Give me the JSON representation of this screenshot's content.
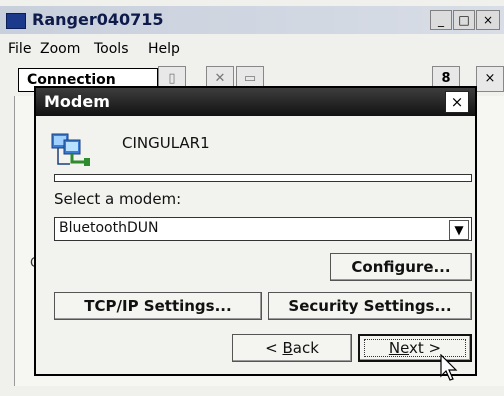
{
  "window": {
    "title": "Ranger040715",
    "minimize_label": "_",
    "maximize_label": "□",
    "close_label": "×"
  },
  "menubar": {
    "items": [
      "File",
      "Zoom",
      "Tools",
      "Help"
    ]
  },
  "toolbar": {
    "combo_text": "Connection",
    "right_partial_1": "8",
    "right_partial_2": "×"
  },
  "background": {
    "partial_text": "C"
  },
  "dialog": {
    "title": "Modem",
    "close_label": "×",
    "connection_name": "CINGULAR1",
    "select_label": "Select a modem:",
    "selected_modem": "BluetoothDUN",
    "dropdown_arrow": "▼",
    "buttons": {
      "configure": "Configure...",
      "tcpip": "TCP/IP Settings...",
      "security": "Security Settings...",
      "back_prefix": "< ",
      "back_underlined": "B",
      "back_rest": "ack",
      "next_underlined": "Ne",
      "next_rest": "xt >"
    }
  },
  "colors": {
    "dialog_title_bg": "#1a1a1a",
    "window_title_text": "#0e1a4a"
  },
  "icons": [
    "app-icon",
    "connection-icon",
    "cursor-pointer-icon"
  ]
}
